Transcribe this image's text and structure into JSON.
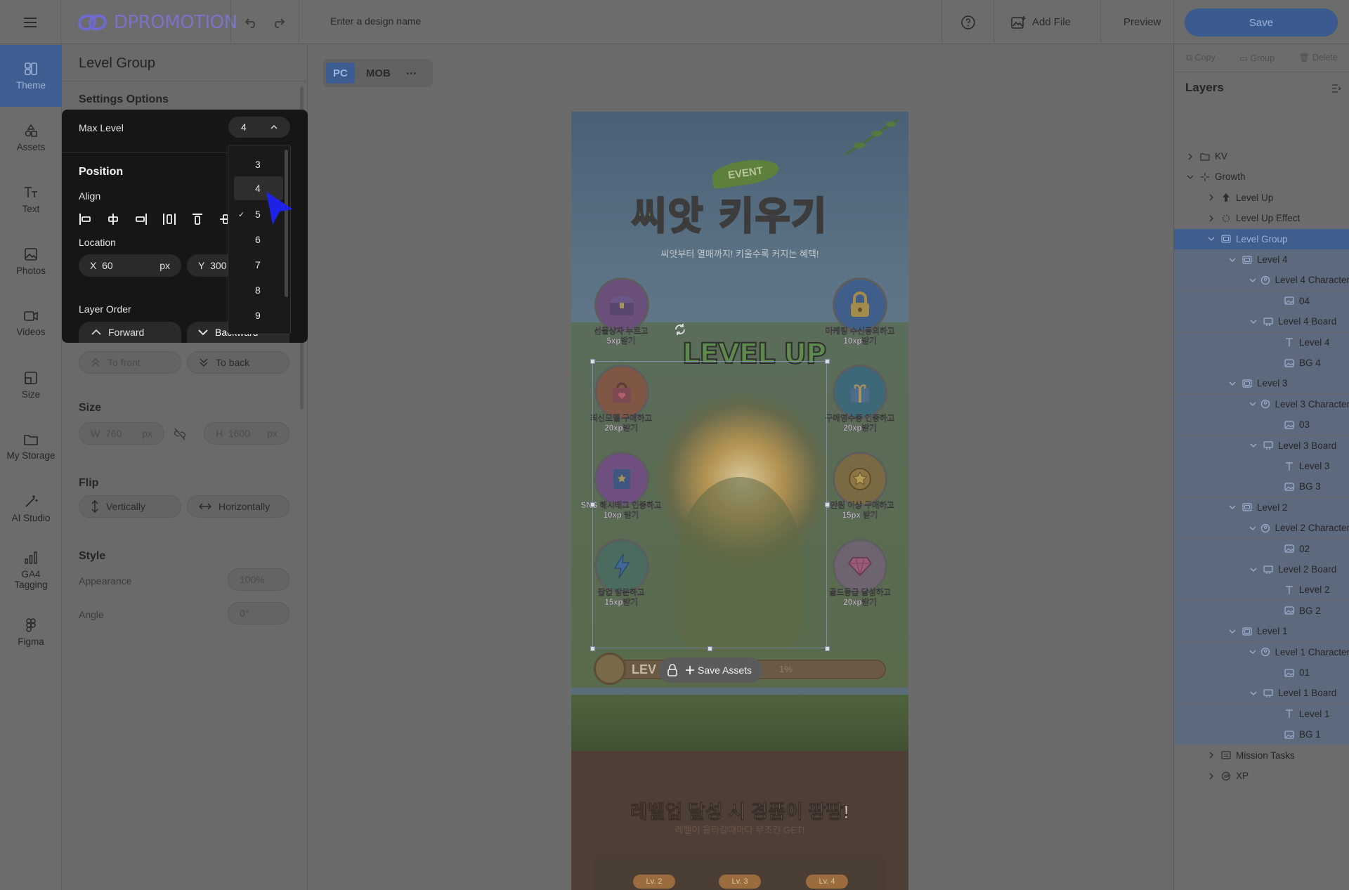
{
  "brand": {
    "logo_text": "DPROMOTION"
  },
  "topbar": {
    "design_name_placeholder": "Enter a design name",
    "add_file": "Add File",
    "preview": "Preview",
    "save": "Save"
  },
  "nav": [
    {
      "label": "Theme",
      "icon": "theme-icon"
    },
    {
      "label": "Assets",
      "icon": "assets-icon"
    },
    {
      "label": "Text",
      "icon": "text-icon"
    },
    {
      "label": "Photos",
      "icon": "photos-icon"
    },
    {
      "label": "Videos",
      "icon": "videos-icon"
    },
    {
      "label": "Size",
      "icon": "size-icon"
    },
    {
      "label": "My Storage",
      "icon": "folder-icon"
    },
    {
      "label": "AI Studio",
      "icon": "wand-icon"
    },
    {
      "label": "GA4 Tagging",
      "icon": "bar-chart-icon"
    },
    {
      "label": "Figma",
      "icon": "figma-icon"
    }
  ],
  "settings": {
    "title": "Level Group",
    "options_title": "Settings Options",
    "max_level_label": "Max Level",
    "max_level_value": "4",
    "max_level_options": [
      "3",
      "4",
      "5",
      "6",
      "7",
      "8",
      "9"
    ],
    "max_level_checked": "5",
    "position_title": "Position",
    "align_label": "Align",
    "location_label": "Location",
    "x_label": "X",
    "x_value": "60",
    "y_label": "Y",
    "y_value": "300",
    "unit": "px",
    "layer_order_label": "Layer Order",
    "forward": "Forward",
    "backward": "Backward",
    "to_front": "To front",
    "to_back": "To back",
    "size_title": "Size",
    "w_label": "W",
    "w_value": "760",
    "h_label": "H",
    "h_value": "1600",
    "flip_title": "Flip",
    "vertically": "Vertically",
    "horizontally": "Horizontally",
    "style_title": "Style",
    "appearance_label": "Appearance",
    "appearance_value": "100%",
    "angle_label": "Angle",
    "angle_value": "0°"
  },
  "canvas": {
    "tabs": [
      "PC",
      "MOB"
    ],
    "active_tab": "PC",
    "event_tag": "EVENT",
    "title": "씨앗 키우기",
    "subtitle": "씨앗부터 열매까지! 키울수록 커지는 혜택!",
    "levelup_text": "LEVEL UP",
    "missions": [
      {
        "line1": "선물상자 누르고",
        "line2": "5xp받기"
      },
      {
        "line1": "마케팅 수신동의하고",
        "line2": "10xp받기"
      },
      {
        "line1": "최신모델 구매하고",
        "line2": "20xp받기"
      },
      {
        "line1": "구매영수증 인증하고",
        "line2": "20xp받기"
      },
      {
        "line1": "SNS 해시태그 인증하고",
        "line2": "10xp 받기"
      },
      {
        "line1": "5만원 이상 구매하고",
        "line2": "15px 받기"
      },
      {
        "line1": "팝업 방문하고",
        "line2": "15xp받기"
      },
      {
        "line1": "골드등급 달성하고",
        "line2": "20xp받기"
      }
    ],
    "progress_label": "LEV",
    "progress_percent": "1%",
    "save_assets": "Save Assets",
    "bottom_title_hot": "레벨업",
    "bottom_title_rest": " 달성 시 경품이 팡팡!",
    "bottom_subtitle": "레벨이 올라갈때마다 무조건 GET!",
    "level_chips": [
      "Lv. 2",
      "Lv. 3",
      "Lv. 4"
    ]
  },
  "rightpanel": {
    "copy": "Copy",
    "group": "Group",
    "delete": "Delete",
    "layers_title": "Layers",
    "layers": [
      {
        "label": "KV",
        "depth": 0,
        "icon": "folder-icon",
        "chev": "right"
      },
      {
        "label": "Growth",
        "depth": 0,
        "icon": "sparkle-icon",
        "chev": "down"
      },
      {
        "label": "Level Up",
        "depth": 1,
        "icon": "up-arrow-icon",
        "chev": "right"
      },
      {
        "label": "Level Up Effect",
        "depth": 1,
        "icon": "burst-icon",
        "chev": "right"
      },
      {
        "label": "Level Group",
        "depth": 1,
        "icon": "group-icon",
        "chev": "down"
      },
      {
        "label": "Level 4",
        "depth": 2,
        "icon": "group-icon",
        "chev": "down"
      },
      {
        "label": "Level 4 Character",
        "depth": 3,
        "icon": "character-icon",
        "chev": "down"
      },
      {
        "label": "04",
        "depth": 4,
        "icon": "image-icon",
        "chev": ""
      },
      {
        "label": "Level 4 Board",
        "depth": 3,
        "icon": "board-icon",
        "chev": "down"
      },
      {
        "label": "Level 4",
        "depth": 4,
        "icon": "text-icon",
        "chev": ""
      },
      {
        "label": "BG 4",
        "depth": 4,
        "icon": "image-icon",
        "chev": ""
      },
      {
        "label": "Level 3",
        "depth": 2,
        "icon": "group-icon",
        "chev": "down"
      },
      {
        "label": "Level 3 Character",
        "depth": 3,
        "icon": "character-icon",
        "chev": "down"
      },
      {
        "label": "03",
        "depth": 4,
        "icon": "image-icon",
        "chev": ""
      },
      {
        "label": "Level 3 Board",
        "depth": 3,
        "icon": "board-icon",
        "chev": "down"
      },
      {
        "label": "Level 3",
        "depth": 4,
        "icon": "text-icon",
        "chev": ""
      },
      {
        "label": "BG 3",
        "depth": 4,
        "icon": "image-icon",
        "chev": ""
      },
      {
        "label": "Level 2",
        "depth": 2,
        "icon": "group-icon",
        "chev": "down"
      },
      {
        "label": "Level 2 Character",
        "depth": 3,
        "icon": "character-icon",
        "chev": "down"
      },
      {
        "label": "02",
        "depth": 4,
        "icon": "image-icon",
        "chev": ""
      },
      {
        "label": "Level 2 Board",
        "depth": 3,
        "icon": "board-icon",
        "chev": "down"
      },
      {
        "label": "Level 2",
        "depth": 4,
        "icon": "text-icon",
        "chev": ""
      },
      {
        "label": "BG 2",
        "depth": 4,
        "icon": "image-icon",
        "chev": ""
      },
      {
        "label": "Level 1",
        "depth": 2,
        "icon": "group-icon",
        "chev": "down"
      },
      {
        "label": "Level 1 Character",
        "depth": 3,
        "icon": "character-icon",
        "chev": "down"
      },
      {
        "label": "01",
        "depth": 4,
        "icon": "image-icon",
        "chev": ""
      },
      {
        "label": "Level 1 Board",
        "depth": 3,
        "icon": "board-icon",
        "chev": "down"
      },
      {
        "label": "Level 1",
        "depth": 4,
        "icon": "text-icon",
        "chev": ""
      },
      {
        "label": "BG 1",
        "depth": 4,
        "icon": "image-icon",
        "chev": ""
      },
      {
        "label": "Mission Tasks",
        "depth": 1,
        "icon": "list-icon",
        "chev": "right"
      },
      {
        "label": "XP",
        "depth": 1,
        "icon": "xp-icon",
        "chev": "right"
      }
    ],
    "selected_layer": "Level Group"
  },
  "colors": {
    "accent": "#3e5d90",
    "dim_overlay": "#6b6b6b",
    "popup_bg": "#161616",
    "cursor": "#1e22e6"
  }
}
